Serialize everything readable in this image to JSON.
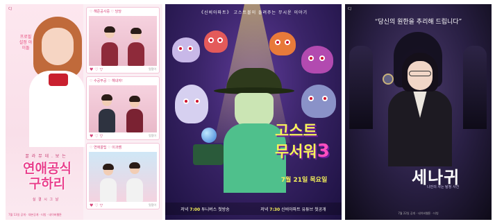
{
  "posters": [
    {
      "logo": "CJ",
      "side_text": "프로필 설정 아이돌",
      "cards": [
        {
          "caption": "♡ 해준공사중 ♡ 당당",
          "likes": "♥ ♡ ▽",
          "tag": "멋쟁이"
        },
        {
          "caption": "♡ 수공부공 ♡ 해내자!",
          "likes": "♥ ♡ ▽",
          "tag": "멋쟁이"
        },
        {
          "caption": "♡ 연애꿀팁 ♡ 이과쌤",
          "likes": "♥ ♡ ▽",
          "tag": "멋쟁이"
        }
      ],
      "subtitle": "꿀 라 뮤 데 . 보 는",
      "title_line1": "연애공식",
      "title_line2": "구하리",
      "date": "실 결 시 그 날",
      "footer": "7월 13일 공개 · 대본공개 · 티빙 · 네이버웹툰"
    },
    {
      "tagline": "《신비아파트》 고스트볼이 들려주는 무시운 이야기",
      "title_line1": "고스트",
      "title_line2": "무서워",
      "title_number": "3",
      "date": "7월 21일 목요일",
      "schedule_1_prefix": "저녁",
      "schedule_1_time": "7:00",
      "schedule_1_text": "투니버스 첫방송",
      "schedule_2_prefix": "저녁",
      "schedule_2_time": "7:30",
      "schedule_2_text": "신비아파트 유튜브 첫공개"
    },
    {
      "logo": "CJ",
      "quote": "“당신의 원한을 추리해 드립니다”",
      "title": "세나귀",
      "subtitle": "나만의 사는 탐정 사건",
      "footer": "7월 22일 공개 · 네이버웹툰 · 티빙"
    }
  ],
  "colors": {
    "pink": "#e93f8c",
    "purple": "#3a2468",
    "yellow": "#f6f25a",
    "dark": "#1a1530"
  }
}
